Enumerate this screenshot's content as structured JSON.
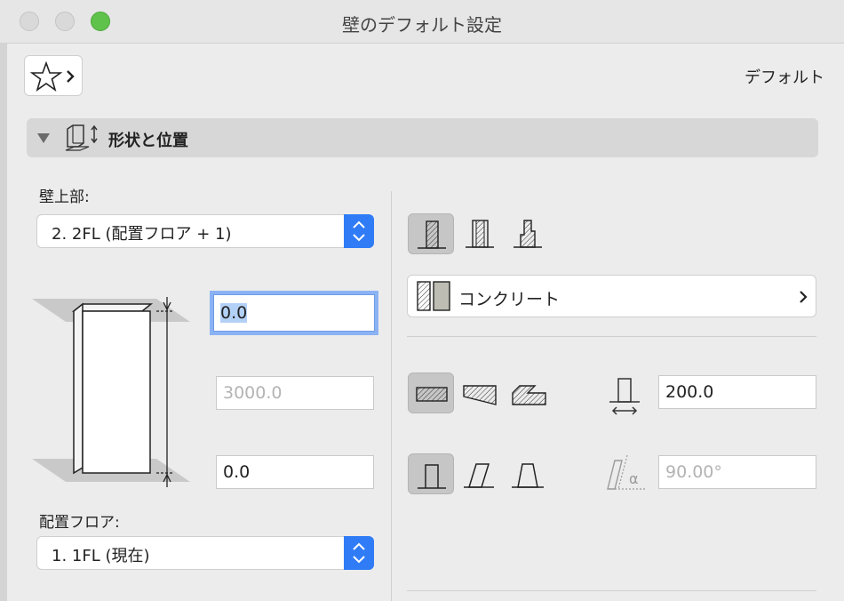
{
  "window": {
    "title": "壁のデフォルト設定"
  },
  "header": {
    "preset_name": "デフォルト"
  },
  "section": {
    "title": "形状と位置"
  },
  "top_link": {
    "label": "壁上部:",
    "value": "2. 2FL (配置フロア + 1)"
  },
  "home_story": {
    "label": "配置フロア:",
    "value": "1. 1FL (現在)"
  },
  "offsets": {
    "top_offset": "0.0",
    "height": "3000.0",
    "bottom_offset": "0.0"
  },
  "structure": {
    "material": "コンクリート"
  },
  "geometry": {
    "thickness": "200.0",
    "slant_angle": "90.00°"
  },
  "icons": {
    "favorites": "star-icon",
    "section": "wall-geometry-icon",
    "material": "composite-swatch-icon"
  },
  "colors": {
    "accent": "#2f7cf6",
    "focus_ring": "#8bb3f4",
    "selection": "#b3d1f6"
  }
}
